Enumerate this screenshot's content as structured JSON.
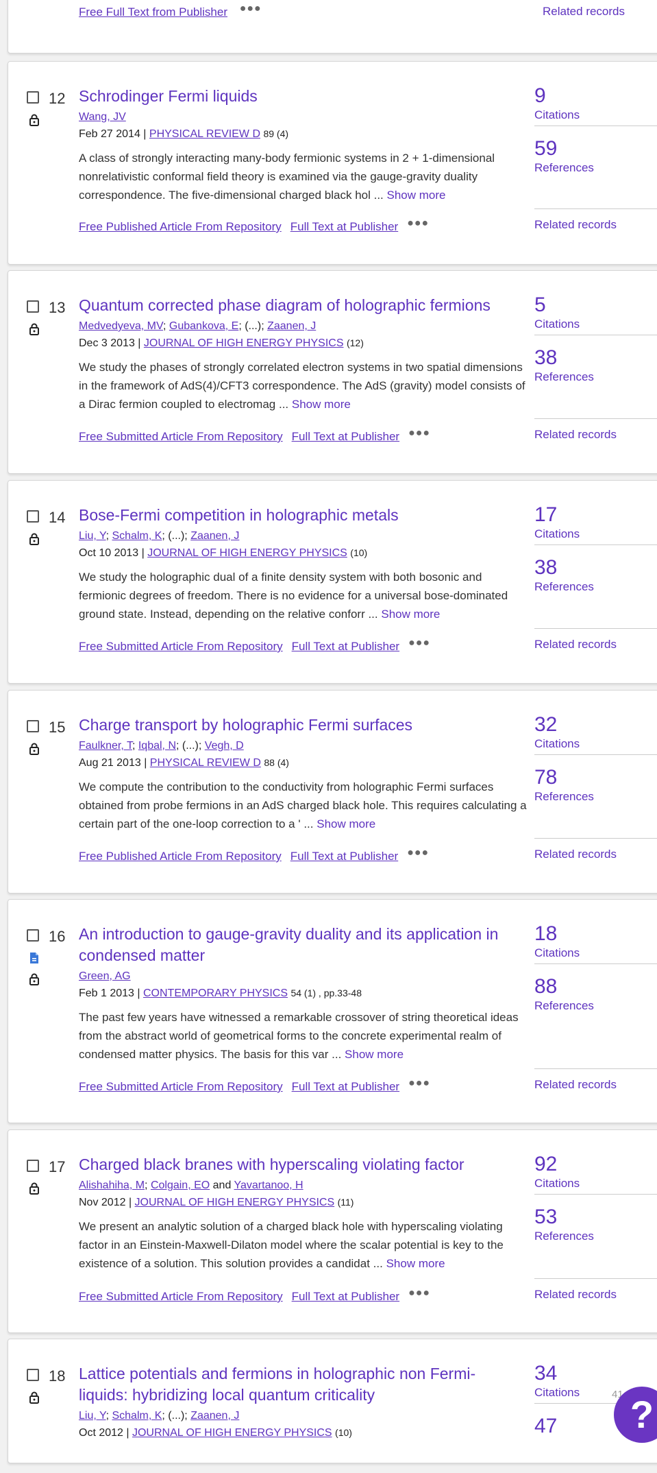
{
  "colors": {
    "accent": "#5e33bf",
    "help_button": "#6a35c2",
    "doc_icon": "#3a78d8"
  },
  "top_fragment": {
    "links": [
      {
        "label": "Free Full Text from Publisher"
      }
    ],
    "related": "Related records"
  },
  "records": [
    {
      "index": "12",
      "title": "Schrodinger Fermi liquids",
      "authors": [
        {
          "name": "Wang, JV",
          "link": true
        }
      ],
      "date": "Feb 27 2014",
      "journal": "PHYSICAL REVIEW D",
      "volume": "89 (4)",
      "abstract": "A class of strongly interacting many-body fermionic systems in 2 + 1-dimensional nonrelativistic conformal field theory is examined via the gauge-gravity duality correspondence. The five-dimensional charged black hol ...",
      "show_more": "Show more",
      "links": [
        "Free Published Article From Repository",
        "Full Text at Publisher"
      ],
      "citations": "9",
      "citations_label": "Citations",
      "references": "59",
      "references_label": "References",
      "related": "Related records",
      "icons": [
        "lock-icon"
      ]
    },
    {
      "index": "13",
      "title": "Quantum corrected phase diagram of holographic fermions",
      "authors": [
        {
          "name": "Medvedyeva, MV",
          "link": true
        },
        {
          "name": "Gubankova, E",
          "link": true
        },
        {
          "name": "(...)",
          "link": false
        },
        {
          "name": "Zaanen, J",
          "link": true
        }
      ],
      "date": "Dec 3 2013",
      "journal": "JOURNAL OF HIGH ENERGY PHYSICS",
      "volume": "(12)",
      "abstract": "We study the phases of strongly correlated electron systems in two spatial dimensions in the framework of AdS(4)/CFT3 correspondence. The AdS (gravity) model consists of a Dirac fermion coupled to electromag ...",
      "show_more": "Show more",
      "links": [
        "Free Submitted Article From Repository",
        "Full Text at Publisher"
      ],
      "citations": "5",
      "citations_label": "Citations",
      "references": "38",
      "references_label": "References",
      "related": "Related records",
      "icons": [
        "lock-icon"
      ]
    },
    {
      "index": "14",
      "title": "Bose-Fermi competition in holographic metals",
      "authors": [
        {
          "name": "Liu, Y",
          "link": true
        },
        {
          "name": "Schalm, K",
          "link": true
        },
        {
          "name": "(...)",
          "link": false
        },
        {
          "name": "Zaanen, J",
          "link": true
        }
      ],
      "date": "Oct 10 2013",
      "journal": "JOURNAL OF HIGH ENERGY PHYSICS",
      "volume": "(10)",
      "abstract": "We study the holographic dual of a finite density system with both bosonic and fermionic degrees of freedom. There is no evidence for a universal bose-dominated ground state. Instead, depending on the relative conforr ...",
      "show_more": "Show more",
      "links": [
        "Free Submitted Article From Repository",
        "Full Text at Publisher"
      ],
      "citations": "17",
      "citations_label": "Citations",
      "references": "38",
      "references_label": "References",
      "related": "Related records",
      "icons": [
        "lock-icon"
      ]
    },
    {
      "index": "15",
      "title": "Charge transport by holographic Fermi surfaces",
      "authors": [
        {
          "name": "Faulkner, T",
          "link": true
        },
        {
          "name": "Iqbal, N",
          "link": true
        },
        {
          "name": "(...)",
          "link": false
        },
        {
          "name": "Vegh, D",
          "link": true
        }
      ],
      "date": "Aug 21 2013",
      "journal": "PHYSICAL REVIEW D",
      "volume": "88 (4)",
      "abstract": "We compute the contribution to the conductivity from holographic Fermi surfaces obtained from probe fermions in an AdS charged black hole. This requires calculating a certain part of the one-loop correction to a ' ...",
      "show_more": "Show more",
      "links": [
        "Free Published Article From Repository",
        "Full Text at Publisher"
      ],
      "citations": "32",
      "citations_label": "Citations",
      "references": "78",
      "references_label": "References",
      "related": "Related records",
      "icons": [
        "lock-icon"
      ]
    },
    {
      "index": "16",
      "title": "An introduction to gauge-gravity duality and its application in condensed matter",
      "authors": [
        {
          "name": "Green, AG",
          "link": true
        }
      ],
      "date": "Feb 1 2013",
      "journal": "CONTEMPORARY PHYSICS",
      "volume": "54 (1) , pp.33-48",
      "abstract": "The past few years have witnessed a remarkable crossover of string theoretical ideas from the abstract world of geometrical forms to the concrete experimental realm of condensed matter physics. The basis for this var ...",
      "show_more": "Show more",
      "links": [
        "Free Submitted Article From Repository",
        "Full Text at Publisher"
      ],
      "citations": "18",
      "citations_label": "Citations",
      "references": "88",
      "references_label": "References",
      "related": "Related records",
      "icons": [
        "document-icon",
        "lock-icon"
      ]
    },
    {
      "index": "17",
      "title": "Charged black branes with hyperscaling violating factor",
      "authors": [
        {
          "name": "Alishahiha, M",
          "link": true
        },
        {
          "name": "Colgain, EO",
          "link": true
        },
        {
          "name": "and",
          "link": false
        },
        {
          "name": "Yavartanoo, H",
          "link": true
        }
      ],
      "date": "Nov 2012",
      "journal": "JOURNAL OF HIGH ENERGY PHYSICS",
      "volume": "(11)",
      "abstract": "We present an analytic solution of a charged black hole with hyperscaling violating factor in an Einstein-Maxwell-Dilaton model where the scalar potential is key to the existence of a solution. This solution provides a candidat ...",
      "show_more": "Show more",
      "links": [
        "Free Submitted Article From Repository",
        "Full Text at Publisher"
      ],
      "citations": "92",
      "citations_label": "Citations",
      "references": "53",
      "references_label": "References",
      "related": "Related records",
      "icons": [
        "lock-icon"
      ]
    },
    {
      "index": "18",
      "title": "Lattice potentials and fermions in holographic non Fermi-liquids: hybridizing local quantum criticality",
      "authors": [
        {
          "name": "Liu, Y",
          "link": true
        },
        {
          "name": "Schalm, K",
          "link": true
        },
        {
          "name": "(...)",
          "link": false
        },
        {
          "name": "Zaanen, J",
          "link": true
        }
      ],
      "date": "Oct 2012",
      "journal": "JOURNAL OF HIGH ENERGY PHYSICS",
      "volume": "(10)",
      "citations": "34",
      "citations_label": "Citations",
      "references": "47",
      "icons": [
        "lock-icon"
      ]
    }
  ],
  "page_count": "41",
  "help_button": "?"
}
